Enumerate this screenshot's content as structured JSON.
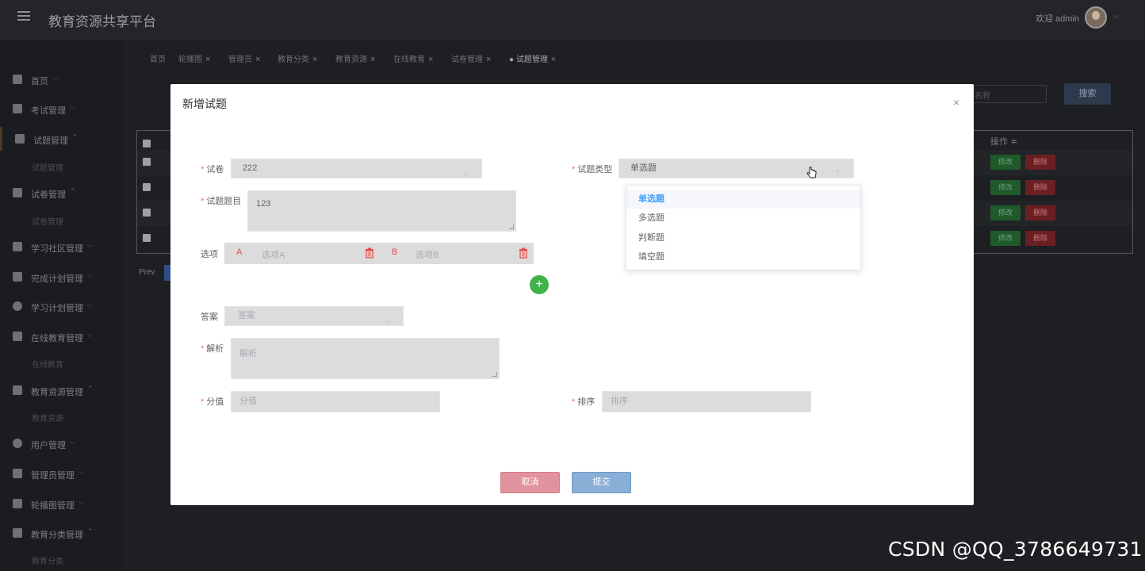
{
  "topbar": {
    "title": "教育资源共享平台",
    "welcome": "欢迎 admin"
  },
  "sidebar": {
    "items": [
      {
        "label": "首页"
      },
      {
        "label": "考试管理"
      },
      {
        "label": "试题管理"
      },
      {
        "label": "试题管理"
      },
      {
        "label": "试卷管理"
      },
      {
        "label": "试卷管理"
      },
      {
        "label": "学习社区管理"
      },
      {
        "label": "完成计划管理"
      },
      {
        "label": "学习计划管理"
      },
      {
        "label": "在线教育管理"
      },
      {
        "label": "在线教育"
      },
      {
        "label": "教育资源管理"
      },
      {
        "label": "教育资源"
      },
      {
        "label": "用户管理"
      },
      {
        "label": "管理员管理"
      },
      {
        "label": "轮播图管理"
      },
      {
        "label": "教育分类管理"
      },
      {
        "label": "教育分类"
      }
    ]
  },
  "tabs": [
    {
      "label": "首页"
    },
    {
      "label": "轮播图"
    },
    {
      "label": "管理员"
    },
    {
      "label": "教育分类"
    },
    {
      "label": "教育资源"
    },
    {
      "label": "在线教育"
    },
    {
      "label": "试卷管理"
    },
    {
      "label": "试题管理"
    }
  ],
  "list": {
    "search_placeholder": "名称",
    "search_label": "搜索",
    "op_header": "操作 ≑",
    "edit_label": "修改",
    "delete_label": "删除",
    "prev_label": "Prev"
  },
  "modal": {
    "title": "新增试题",
    "close": "×",
    "paper_label": "试卷",
    "paper_value": "222",
    "type_label": "试题类型",
    "type_value": "单选题",
    "question_label": "试题题目",
    "question_value": "123",
    "options_label": "选项",
    "option_a_letter": "A",
    "option_a_placeholder": "选项A",
    "option_b_letter": "B",
    "option_b_placeholder": "选项B",
    "add_symbol": "+",
    "answer_label": "答案",
    "answer_placeholder": "答案",
    "analysis_label": "解析",
    "analysis_placeholder": "解析",
    "score_label": "分值",
    "score_placeholder": "分值",
    "sort_label": "排序",
    "sort_placeholder": "排序",
    "cancel_label": "取消",
    "submit_label": "提交",
    "type_options": [
      "单选题",
      "多选题",
      "判断题",
      "填空题"
    ]
  },
  "watermark": "CSDN @QQ_3786649731",
  "colors": {
    "accent": "#409eff",
    "required": "#f56c6c",
    "add_button": "#3fb24a",
    "cancel_button": "#e0939c",
    "submit_button": "#8aafd6"
  }
}
